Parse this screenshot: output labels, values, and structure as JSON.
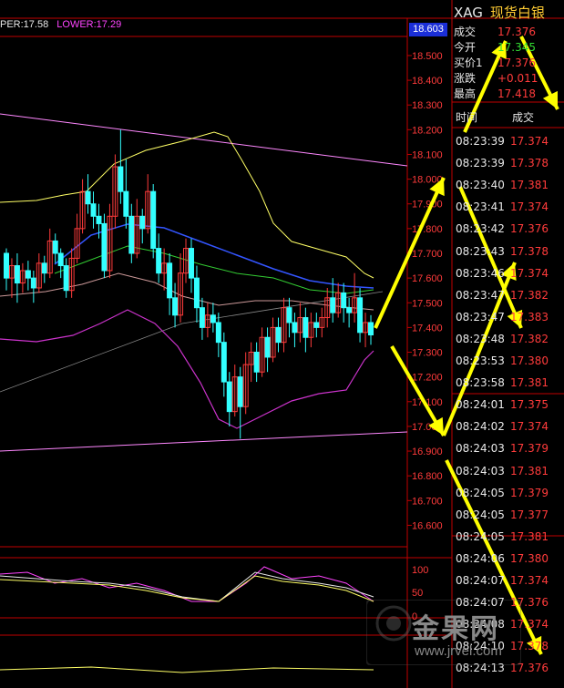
{
  "indicator": {
    "upper_label": "PER:17.58",
    "lower_label": "LOWER:17.29"
  },
  "current_price_tag": "18.603",
  "panel": {
    "symbol": "XAG",
    "name": "现货白银",
    "quote": [
      {
        "label": "成交",
        "value": "17.376",
        "color": "#ff3b3b"
      },
      {
        "label": "今开",
        "value": "17.345",
        "color": "#33dd33"
      },
      {
        "label": "买价1",
        "value": "17.376",
        "color": "#ff3b3b"
      },
      {
        "label": "涨跌",
        "value": "+0.011",
        "color": "#ff3b3b"
      },
      {
        "label": "最高",
        "value": "17.418",
        "color": "#ff3b3b"
      }
    ],
    "col_time": "时间",
    "col_deal": "成交",
    "ticks": [
      [
        "08:23:39",
        "17.374"
      ],
      [
        "08:23:39",
        "17.378"
      ],
      [
        "08:23:40",
        "17.381"
      ],
      [
        "08:23:41",
        "17.374"
      ],
      [
        "08:23:42",
        "17.376"
      ],
      [
        "08:23:43",
        "17.378"
      ],
      [
        "08:23:46",
        "17.374"
      ],
      [
        "08:23:47",
        "17.382"
      ],
      [
        "08:23:47",
        "17.383"
      ],
      [
        "08:23:48",
        "17.382"
      ],
      [
        "08:23:53",
        "17.380"
      ],
      [
        "08:23:58",
        "17.381"
      ],
      [
        "08:24:01",
        "17.375"
      ],
      [
        "08:24:02",
        "17.374"
      ],
      [
        "08:24:03",
        "17.379"
      ],
      [
        "08:24:03",
        "17.381"
      ],
      [
        "08:24:05",
        "17.379"
      ],
      [
        "08:24:05",
        "17.377"
      ],
      [
        "08:24:05",
        "17.381"
      ],
      [
        "08:24:06",
        "17.380"
      ],
      [
        "08:24:07",
        "17.374"
      ],
      [
        "08:24:07",
        "17.376"
      ],
      [
        "08:24:08",
        "17.374"
      ],
      [
        "08:24:10",
        "17.378"
      ],
      [
        "08:24:13",
        "17.376"
      ]
    ]
  },
  "watermark": {
    "text": "金果网",
    "url": "www.jrvel.com"
  },
  "colors": {
    "up_candle": "#ff3b3b",
    "down_candle": "#33ffff",
    "arrow": "#ffff00",
    "frame": "#c00000",
    "ma_yellow": "#ffff66",
    "ma_white": "#e8e8e8",
    "ma_green": "#33cc33",
    "ma_blue": "#3355ff",
    "band": "#cc33cc"
  },
  "chart_data": {
    "type": "candlestick",
    "y_axis": {
      "ticks": [
        "18.500",
        "18.400",
        "18.300",
        "18.200",
        "18.100",
        "18.000",
        "17.900",
        "17.800",
        "17.700",
        "17.600",
        "17.500",
        "17.400",
        "17.300",
        "17.200",
        "17.100",
        "17.000",
        "16.900",
        "16.800",
        "16.700",
        "16.600"
      ],
      "range": [
        16.55,
        18.603
      ]
    },
    "sub_axis": {
      "ticks": [
        "100",
        "50",
        "0"
      ]
    },
    "bollinger": {
      "upper": 17.58,
      "lower": 17.29
    },
    "candles": [
      [
        17.7,
        17.6,
        17.72,
        17.55
      ],
      [
        17.6,
        17.65,
        17.68,
        17.52
      ],
      [
        17.65,
        17.58,
        17.7,
        17.5
      ],
      [
        17.58,
        17.63,
        17.66,
        17.54
      ],
      [
        17.63,
        17.6,
        17.67,
        17.55
      ],
      [
        17.6,
        17.56,
        17.63,
        17.5
      ],
      [
        17.56,
        17.66,
        17.7,
        17.54
      ],
      [
        17.66,
        17.62,
        17.69,
        17.58
      ],
      [
        17.62,
        17.75,
        17.8,
        17.6
      ],
      [
        17.75,
        17.7,
        17.78,
        17.66
      ],
      [
        17.7,
        17.65,
        17.72,
        17.6
      ],
      [
        17.65,
        17.55,
        17.68,
        17.52
      ],
      [
        17.55,
        17.68,
        17.72,
        17.52
      ],
      [
        17.68,
        17.8,
        17.86,
        17.66
      ],
      [
        17.8,
        17.95,
        18.0,
        17.78
      ],
      [
        17.95,
        17.9,
        18.02,
        17.86
      ],
      [
        17.9,
        17.85,
        17.95,
        17.8
      ],
      [
        17.85,
        17.82,
        17.9,
        17.76
      ],
      [
        17.82,
        17.63,
        17.86,
        17.6
      ],
      [
        17.63,
        17.85,
        17.9,
        17.6
      ],
      [
        17.85,
        18.05,
        18.1,
        17.8
      ],
      [
        18.05,
        17.95,
        18.2,
        17.9
      ],
      [
        17.95,
        17.85,
        18.08,
        17.8
      ],
      [
        17.85,
        17.7,
        17.9,
        17.66
      ],
      [
        17.7,
        17.85,
        17.92,
        17.68
      ],
      [
        17.85,
        17.8,
        17.88,
        17.74
      ],
      [
        17.8,
        17.95,
        18.02,
        17.78
      ],
      [
        17.95,
        17.72,
        17.98,
        17.68
      ],
      [
        17.72,
        17.62,
        17.78,
        17.58
      ],
      [
        17.62,
        17.66,
        17.72,
        17.55
      ],
      [
        17.66,
        17.52,
        17.7,
        17.45
      ],
      [
        17.52,
        17.45,
        17.58,
        17.4
      ],
      [
        17.45,
        17.62,
        17.7,
        17.42
      ],
      [
        17.62,
        17.72,
        17.76,
        17.58
      ],
      [
        17.72,
        17.6,
        17.76,
        17.54
      ],
      [
        17.6,
        17.48,
        17.65,
        17.42
      ],
      [
        17.48,
        17.4,
        17.52,
        17.35
      ],
      [
        17.4,
        17.45,
        17.5,
        17.36
      ],
      [
        17.45,
        17.42,
        17.5,
        17.38
      ],
      [
        17.42,
        17.34,
        17.46,
        17.28
      ],
      [
        17.34,
        17.18,
        17.38,
        17.12
      ],
      [
        17.18,
        17.06,
        17.22,
        17.0
      ],
      [
        17.06,
        17.2,
        17.25,
        17.04
      ],
      [
        17.2,
        17.08,
        17.24,
        16.95
      ],
      [
        17.08,
        17.25,
        17.3,
        17.05
      ],
      [
        17.25,
        17.3,
        17.34,
        17.18
      ],
      [
        17.3,
        17.22,
        17.34,
        17.18
      ],
      [
        17.22,
        17.36,
        17.4,
        17.2
      ],
      [
        17.36,
        17.28,
        17.4,
        17.22
      ],
      [
        17.28,
        17.4,
        17.44,
        17.26
      ],
      [
        17.4,
        17.34,
        17.44,
        17.3
      ],
      [
        17.34,
        17.48,
        17.52,
        17.3
      ],
      [
        17.48,
        17.42,
        17.52,
        17.36
      ],
      [
        17.42,
        17.38,
        17.46,
        17.32
      ],
      [
        17.38,
        17.44,
        17.5,
        17.34
      ],
      [
        17.44,
        17.36,
        17.48,
        17.3
      ],
      [
        17.36,
        17.42,
        17.46,
        17.32
      ],
      [
        17.42,
        17.4,
        17.46,
        17.36
      ],
      [
        17.4,
        17.44,
        17.48,
        17.36
      ],
      [
        17.44,
        17.52,
        17.56,
        17.4
      ],
      [
        17.52,
        17.46,
        17.6,
        17.42
      ],
      [
        17.46,
        17.54,
        17.58,
        17.44
      ],
      [
        17.54,
        17.48,
        17.58,
        17.42
      ],
      [
        17.48,
        17.46,
        17.52,
        17.4
      ],
      [
        17.46,
        17.52,
        17.62,
        17.42
      ],
      [
        17.52,
        17.38,
        17.56,
        17.34
      ],
      [
        17.38,
        17.42,
        17.46,
        17.32
      ],
      [
        17.42,
        17.37,
        17.45,
        17.33
      ]
    ]
  }
}
